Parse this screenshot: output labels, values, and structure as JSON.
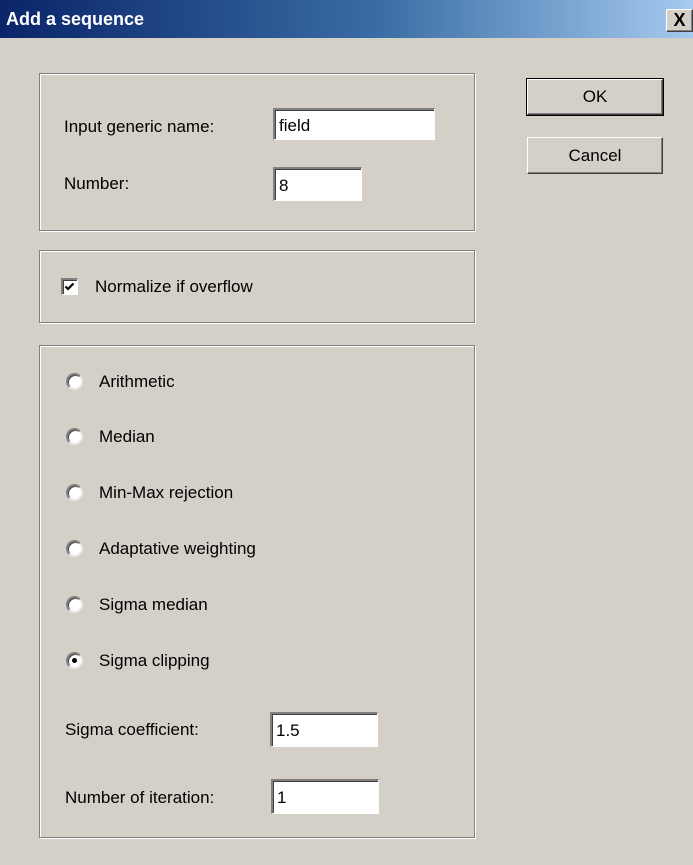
{
  "dialog": {
    "title": "Add a sequence",
    "close_glyph": "X"
  },
  "buttons": {
    "ok_label": "OK",
    "cancel_label": "Cancel"
  },
  "name_group": {
    "generic_name_label": "Input generic name:",
    "generic_name_value": "field",
    "number_label": "Number:",
    "number_value": "8"
  },
  "normalize": {
    "label": "Normalize if overflow",
    "checked": true
  },
  "method_group": {
    "options": [
      {
        "label": "Arithmetic",
        "selected": false
      },
      {
        "label": "Median",
        "selected": false
      },
      {
        "label": "Min-Max rejection",
        "selected": false
      },
      {
        "label": "Adaptative weighting",
        "selected": false
      },
      {
        "label": "Sigma median",
        "selected": false
      },
      {
        "label": "Sigma clipping",
        "selected": true
      }
    ],
    "sigma_coefficient_label": "Sigma coefficient:",
    "sigma_coefficient_value": "1.5",
    "iterations_label": "Number of iteration:",
    "iterations_value": "1"
  },
  "colors": {
    "face": "#d4d0c8",
    "title_start": "#0a246a",
    "title_end": "#a6caf0"
  }
}
